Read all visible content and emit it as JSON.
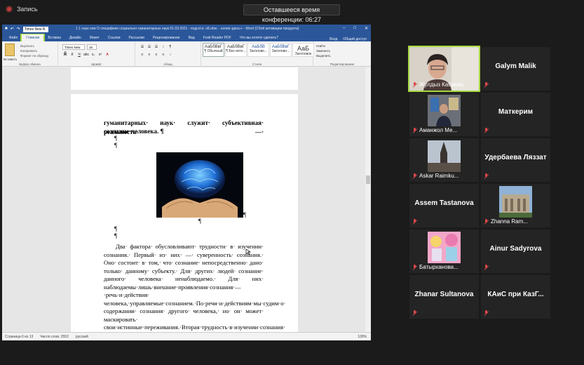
{
  "top": {
    "recording_label": "Запись",
    "timer_text": "Оставшееся время конференции: 06:27"
  },
  "word": {
    "font_box": "Times New R",
    "title": "1 1 наук сем О специфике социально-гуманитарных наук 01.03.2021 - подсоl в .v8.obю. - копия здесь+ - Word (Сбой активации продукта)",
    "tabs": [
      "Файл",
      "Главная",
      "Вставка",
      "Дизайн",
      "Макет",
      "Ссылки",
      "Рассылки",
      "Рецензирование",
      "Вид",
      "Foxit Reader PDF",
      "Что вы хотите сделать?"
    ],
    "tabs_right": [
      "Вход",
      "Общий доступ"
    ],
    "ribbon": {
      "paste": "Вставить",
      "clip_items": [
        "Вырезать",
        "Копировать",
        "Формат по образцу"
      ],
      "font_name": "Times New F",
      "font_size": "16",
      "styles": [
        {
          "sample": "АаБбВвГ",
          "name": "¶ Обычный"
        },
        {
          "sample": "АаБбВвГ",
          "name": "¶ Без инте..."
        },
        {
          "sample": "АаБбВ",
          "name": "Заголово..."
        },
        {
          "sample": "АаБбВвГ",
          "name": "Заголово..."
        },
        {
          "sample": "АаБ",
          "name": "Заголовок"
        }
      ],
      "edit_items": [
        "Найти",
        "Заменить",
        "Выделить"
      ],
      "groups": [
        "Буфер обмена",
        "Шрифт",
        "Абзац",
        "Стили",
        "Редактирование"
      ]
    },
    "doc": {
      "bold_line1": "гуманитарных· наук· служит· субъективная· реальность· —·",
      "bold_line2": "сознание·человека. ¶",
      "pilcrow": "¶",
      "paragraph": "Два· фактора· обусловливают· трудности· в· изучении· сознания.· Первый· из· них· —· суверенность· сознания.· Оно· состоит· в· том,· что· сознание· непосредственно· дано· только· данному· субъекту.· Для· других· людей· сознание· данного· человека· ненаблюдаемо.· Для· них· наблюдаемы·лишь·внешние·проявления·сознания·—·речь·и·действия· человека,·управляемые·сознанием.·По·речи·и·действиям·мы·судим·о· содержании· сознания· другого· человека,· но· он· может· маскировать· свои·истинные·переживания.·Вторая·трудность·в·изучении·сознания· заключается· в· том,· что· в· отличие· от· материальных· вещей· оно· не· материально,· а· идеально.· Как· это· понимать?· Сознание· не· обладает· физическими· и· химическими· свойствами,· какими· обладают· материальные· объекты,· например,· такими· свойствами,· как· заряд,"
    },
    "status": {
      "page": "Страница 6 из 13",
      "words": "Число слов: 2552",
      "lang": "русский",
      "zoom": "100%"
    }
  },
  "participants": [
    {
      "name": "Жулдыз Кабаева",
      "type": "video",
      "active": true
    },
    {
      "name": "Galym Malik",
      "type": "name"
    },
    {
      "name": "Аманжол Ме...",
      "type": "video"
    },
    {
      "name": "Маткерим",
      "type": "name"
    },
    {
      "name": "Askar Raimku...",
      "type": "video"
    },
    {
      "name": "Удербаева  Ляззат",
      "type": "name"
    },
    {
      "name": "Assem Tastanova",
      "type": "name"
    },
    {
      "name": "Zhanna Ram...",
      "type": "video"
    },
    {
      "name": "Батырханова...",
      "type": "video"
    },
    {
      "name": "Ainur Sadyrova",
      "type": "name"
    },
    {
      "name": "Zhanar Sultanova",
      "type": "name"
    },
    {
      "name": "КАиС при КазГ...",
      "type": "name"
    }
  ]
}
